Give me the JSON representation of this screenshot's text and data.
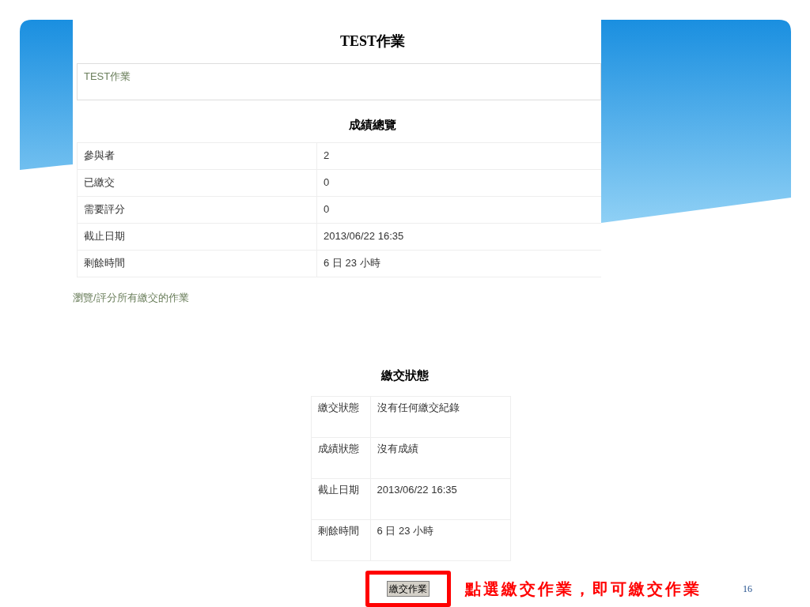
{
  "page_title": "TEST作業",
  "intro": "TEST作業",
  "summary": {
    "heading": "成績總覽",
    "rows": [
      {
        "label": "參與者",
        "value": "2"
      },
      {
        "label": "已繳交",
        "value": "0"
      },
      {
        "label": "需要評分",
        "value": "0"
      },
      {
        "label": "截止日期",
        "value": "2013/06/22 16:35"
      },
      {
        "label": "剩餘時間",
        "value": "6 日 23 小時"
      }
    ]
  },
  "grading_link": "瀏覽/評分所有繳交的作業",
  "status": {
    "heading": "繳交狀態",
    "rows": [
      {
        "label": "繳交狀態",
        "value": "沒有任何繳交紀錄"
      },
      {
        "label": "成績狀態",
        "value": "沒有成績"
      },
      {
        "label": "截止日期",
        "value": "2013/06/22 16:35"
      },
      {
        "label": "剩餘時間",
        "value": "6 日 23 小時"
      }
    ]
  },
  "submit_button": "繳交作業",
  "callout": "點選繳交作業，即可繳交作業",
  "slide_number": "16"
}
